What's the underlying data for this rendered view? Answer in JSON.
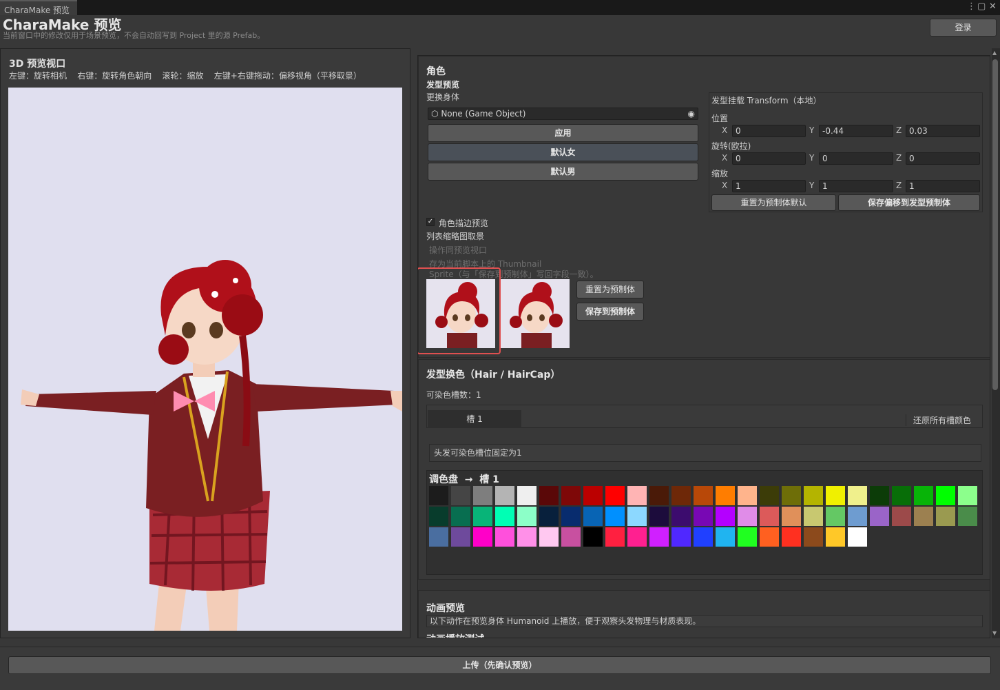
{
  "window": {
    "tab": "CharaMake 预览",
    "menu_icon": "kebab-icon",
    "max_icon": "maximize-icon",
    "close_icon": "close-icon"
  },
  "header": {
    "title": "CharaMake 预览",
    "subtitle": "当前窗口中的修改仅用于场景预览，不会自动回写到 Project 里的源 Prefab。",
    "login": "登录"
  },
  "viewport": {
    "title": "3D 预览视口",
    "help": "左键：旋转相机    右键：旋转角色朝向    滚轮：缩放    左键+右键拖动：偏移视角（平移取景）"
  },
  "character": {
    "section_title": "角色",
    "hair_preview": "发型预览",
    "change_body": "更换身体",
    "object_field": "None (Game Object)",
    "apply": "应用",
    "default_female": "默认女",
    "default_male": "默认男",
    "transform": {
      "title": "发型挂载 Transform（本地）",
      "position_label": "位置",
      "rotation_label": "旋转(欧拉)",
      "scale_label": "缩放",
      "position": {
        "x": "0",
        "y": "-0.44",
        "z": "0.03"
      },
      "rotation": {
        "x": "0",
        "y": "0",
        "z": "0"
      },
      "scale": {
        "x": "1",
        "y": "1",
        "z": "1"
      },
      "axis_x": "X",
      "axis_y": "Y",
      "axis_z": "Z",
      "reset": "重置为预制体默认",
      "save_offset": "保存偏移到发型预制体"
    },
    "outline_preview": "角色描边预览",
    "outline_checked": true,
    "thumb_label": "列表缩略图取景",
    "thumb_hint1": "操作同预览视口",
    "thumb_hint2": "存为当前脚本上的 Thumbnail",
    "thumb_hint3": "Sprite（与「保存到预制体」写回字段一致）。",
    "reset_prefab": "重置为预制体",
    "save_prefab": "保存到预制体"
  },
  "haircolor": {
    "title": "发型换色（Hair / HairCap）",
    "slot_count": "可染色槽数：1",
    "slot_tab": "槽 1",
    "restore": "还原所有槽颜色",
    "info": "头发可染色槽位固定为1",
    "palette_title": "调色盘  →  槽 1",
    "swatches": [
      "#1c1c1c",
      "#454545",
      "#7e7e7e",
      "#b4b4b4",
      "#efefef",
      "#5a0808",
      "#7e0808",
      "#bb0000",
      "#ff0000",
      "#ffb4b4",
      "#4a1a08",
      "#6e2808",
      "#b84808",
      "#ff7d00",
      "#ffb48c",
      "#3c3c08",
      "#6e6e08",
      "#b4b400",
      "#f0f000",
      "#f0f08c",
      "#0c3c08",
      "#086e08",
      "#08b408",
      "#00ff00",
      "#8cff8c",
      "#083c2c",
      "#086e50",
      "#08b478",
      "#00ffb4",
      "#8cffc8",
      "#08203c",
      "#082c6e",
      "#0864b4",
      "#0090ff",
      "#8cd8ff",
      "#1c0c3c",
      "#3c0c6e",
      "#7808b4",
      "#b400ff",
      "#e08ce8",
      "#dc5a5a",
      "#e0905a",
      "#c8c870",
      "#64c864",
      "#6e9cd0",
      "#9a64c8",
      "#9c4a4a",
      "#9c8050",
      "#9a9a50",
      "#4a8c4a",
      "#4a6ea0",
      "#6e4a9c",
      "#ff00c8",
      "#ff50dc",
      "#ff90e8",
      "#ffc8f0",
      "#c850a0",
      "#000000",
      "#ff2040",
      "#ff2090",
      "#d020ff",
      "#5028ff",
      "#2040ff",
      "#20b4f0",
      "#20ff20",
      "#ff6020",
      "#ff3020",
      "#8c4a1c",
      "#ffc828",
      "#ffffff"
    ]
  },
  "animation": {
    "title": "动画预览",
    "desc": "以下动作在预览身体 Humanoid 上播放，便于观察头发物理与材质表现。",
    "next": "动画播放测试"
  },
  "footer": {
    "upload": "上传（先确认预览）"
  }
}
